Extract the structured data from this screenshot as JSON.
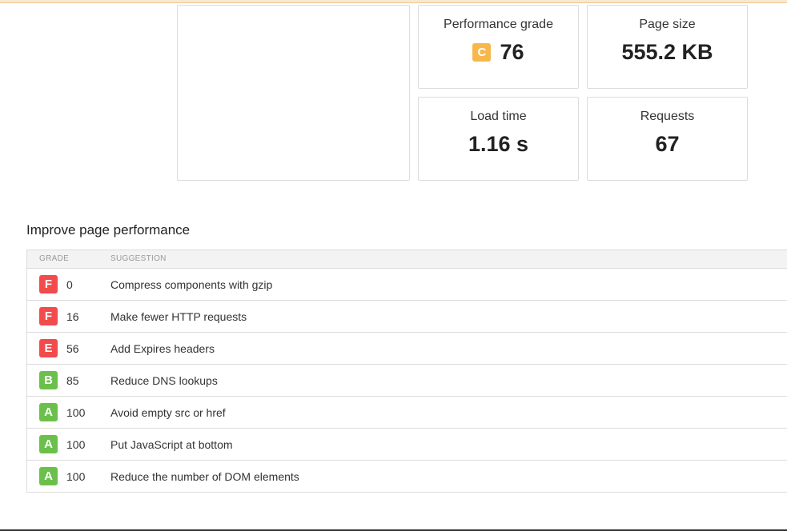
{
  "metrics": {
    "performance_grade": {
      "label": "Performance grade",
      "grade_letter": "C",
      "value": "76"
    },
    "page_size": {
      "label": "Page size",
      "value": "555.2 KB"
    },
    "load_time": {
      "label": "Load time",
      "value": "1.16 s"
    },
    "requests": {
      "label": "Requests",
      "value": "67"
    }
  },
  "improve": {
    "title": "Improve page performance",
    "columns": {
      "grade": "GRADE",
      "suggestion": "SUGGESTION"
    },
    "rows": [
      {
        "grade": "F",
        "score": "0",
        "suggestion": "Compress components with gzip",
        "color": "#f24b4b"
      },
      {
        "grade": "F",
        "score": "16",
        "suggestion": "Make fewer HTTP requests",
        "color": "#f24b4b"
      },
      {
        "grade": "E",
        "score": "56",
        "suggestion": "Add Expires headers",
        "color": "#f24b4b"
      },
      {
        "grade": "B",
        "score": "85",
        "suggestion": "Reduce DNS lookups",
        "color": "#6bc04b"
      },
      {
        "grade": "A",
        "score": "100",
        "suggestion": "Avoid empty src or href",
        "color": "#6bc04b"
      },
      {
        "grade": "A",
        "score": "100",
        "suggestion": "Put JavaScript at bottom",
        "color": "#6bc04b"
      },
      {
        "grade": "A",
        "score": "100",
        "suggestion": "Reduce the number of DOM elements",
        "color": "#6bc04b"
      }
    ]
  },
  "colors": {
    "grade_c": "#f7b84b",
    "grade_fail": "#f24b4b",
    "grade_pass": "#6bc04b"
  }
}
